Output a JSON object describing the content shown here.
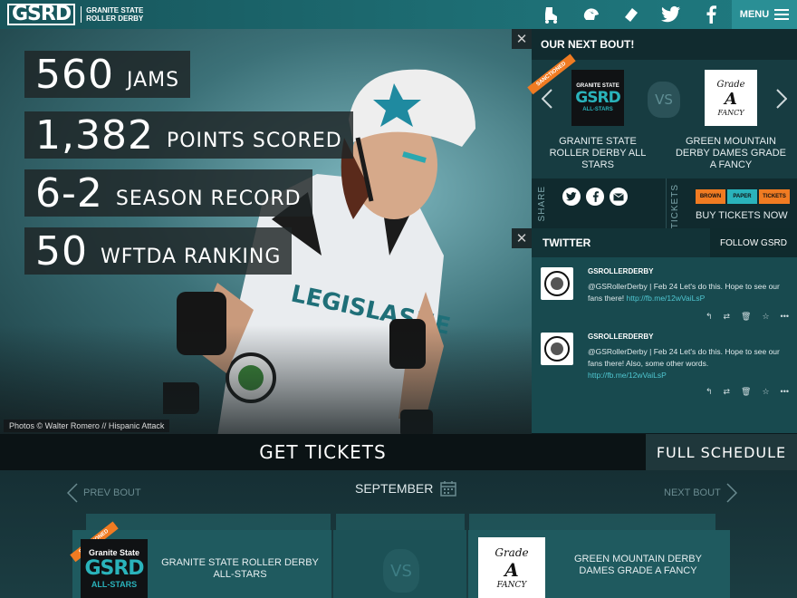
{
  "topbar": {
    "logo_mark": "GSRD",
    "logo_line1": "GRANITE STATE",
    "logo_line2": "ROLLER DERBY",
    "icons": [
      "skate-icon",
      "helmet-icon",
      "ticket-icon",
      "twitter-icon",
      "facebook-icon"
    ],
    "menu_label": "MENU"
  },
  "stats": [
    {
      "number": "560",
      "label": "JAMS"
    },
    {
      "number": "1,382",
      "label": "POINTS SCORED"
    },
    {
      "number": "6-2",
      "label": "SEASON RECORD"
    },
    {
      "number": "50",
      "label": "WFTDA RANKING"
    }
  ],
  "jersey_text": "LEGISLASHE",
  "photo_credit": "Photos © Walter Romero // Hispanic Attack",
  "bout": {
    "title": "OUR NEXT BOUT!",
    "sanctioned": "SANCTIONED",
    "home_logo": {
      "line1": "GRANITE STATE",
      "line2": "GSRD",
      "line3": "ALL-STARS"
    },
    "away_logo": {
      "line1": "Grade",
      "line2": "A",
      "line3": "FANCY"
    },
    "vs": "VS",
    "home_team": "GRANITE STATE ROLLER DERBY ALL STARS",
    "away_team": "GREEN MOUNTAIN DERBY DAMES GRADE A FANCY",
    "share_label": "SHARE",
    "tickets_label": "TICKETS",
    "ticket_tags": [
      "BROWN",
      "PAPER",
      "TICKETS"
    ],
    "buy_label": "BUY TICKETS NOW"
  },
  "twitter": {
    "title": "TWITTER",
    "follow_label": "FOLLOW GSRD",
    "tweets": [
      {
        "name": "GSROLLERDERBY",
        "meta": "@GSRollerDerby  |  Feb 24",
        "text": " Let's do this. Hope to see our fans there! ",
        "link": "http://fb.me/12wVaiLsP"
      },
      {
        "name": "GSROLLERDERBY",
        "meta": "@GSRollerDerby  |  Feb 24",
        "text": " Let's do this. Hope to see our fans there! Also, some other words. ",
        "link": "http://fb.me/12wVaiLsP"
      }
    ],
    "actions": [
      "reply-icon",
      "retweet-icon",
      "delete-icon",
      "favorite-icon",
      "more-icon"
    ]
  },
  "schedule": {
    "get_tickets": "GET TICKETS",
    "full_schedule": "FULL SCHEDULE",
    "prev": "PREV BOUT",
    "next": "NEXT BOUT",
    "month": "SEPTEMBER",
    "sanctioned": "SANCTIONED",
    "home_logo": {
      "line1": "Granite State",
      "line2": "GSRD",
      "line3": "ALL-STARS"
    },
    "away_logo": {
      "line1": "Grade",
      "line2": "A",
      "line3": "FANCY"
    },
    "home_team": "GRANITE STATE ROLLER DERBY ALL-STARS",
    "vs": "VS",
    "away_team": "GREEN MOUNTAIN DERBY DAMES GRADE A FANCY"
  },
  "colors": {
    "brand_teal": "#1d6c72",
    "accent_cyan": "#2ab3bb",
    "sanction_orange": "#f07b22",
    "link": "#4fc6d0"
  }
}
